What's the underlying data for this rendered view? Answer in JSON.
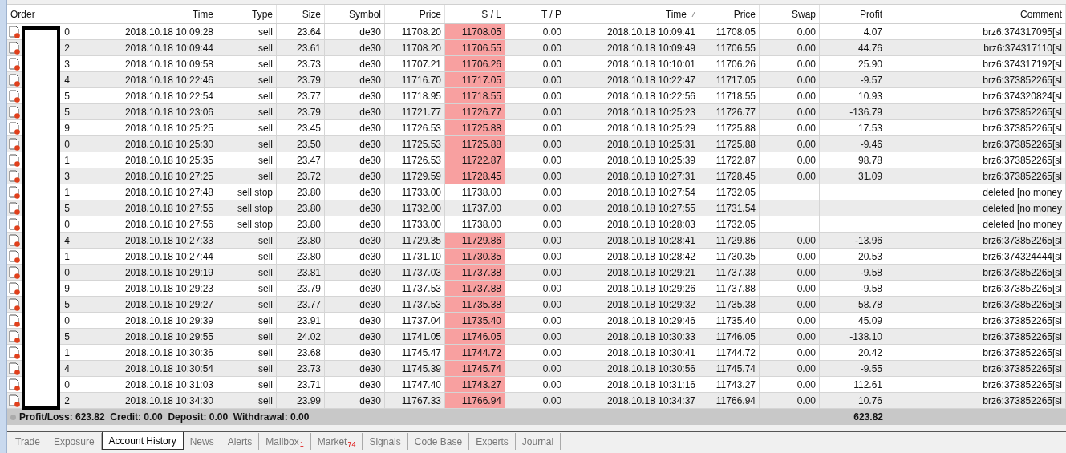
{
  "columns": [
    {
      "label": "Order",
      "sorted": false
    },
    {
      "label": "Time",
      "sorted": false
    },
    {
      "label": "Type",
      "sorted": false
    },
    {
      "label": "Size",
      "sorted": false
    },
    {
      "label": "Symbol",
      "sorted": false
    },
    {
      "label": "Price",
      "sorted": false
    },
    {
      "label": "S / L",
      "sorted": false
    },
    {
      "label": "T / P",
      "sorted": false
    },
    {
      "label": "Time",
      "sorted": true
    },
    {
      "label": "Price",
      "sorted": false
    },
    {
      "label": "Swap",
      "sorted": false
    },
    {
      "label": "Profit",
      "sorted": false
    },
    {
      "label": "Comment",
      "sorted": false
    }
  ],
  "rows": [
    {
      "order": "0",
      "time": "2018.10.18 10:09:28",
      "type": "sell",
      "size": "23.64",
      "symbol": "de30",
      "price": "11708.20",
      "sl": "11708.05",
      "sl_hit": true,
      "tp": "0.00",
      "close_time": "2018.10.18 10:09:41",
      "close_price": "11708.05",
      "swap": "0.00",
      "profit": "4.07",
      "comment": "brz6:374317095[sl"
    },
    {
      "order": "2",
      "time": "2018.10.18 10:09:44",
      "type": "sell",
      "size": "23.61",
      "symbol": "de30",
      "price": "11708.20",
      "sl": "11706.55",
      "sl_hit": true,
      "tp": "0.00",
      "close_time": "2018.10.18 10:09:49",
      "close_price": "11706.55",
      "swap": "0.00",
      "profit": "44.76",
      "comment": "brz6:374317110[sl"
    },
    {
      "order": "3",
      "time": "2018.10.18 10:09:58",
      "type": "sell",
      "size": "23.73",
      "symbol": "de30",
      "price": "11707.21",
      "sl": "11706.26",
      "sl_hit": true,
      "tp": "0.00",
      "close_time": "2018.10.18 10:10:01",
      "close_price": "11706.26",
      "swap": "0.00",
      "profit": "25.90",
      "comment": "brz6:374317192[sl"
    },
    {
      "order": "4",
      "time": "2018.10.18 10:22:46",
      "type": "sell",
      "size": "23.79",
      "symbol": "de30",
      "price": "11716.70",
      "sl": "11717.05",
      "sl_hit": true,
      "tp": "0.00",
      "close_time": "2018.10.18 10:22:47",
      "close_price": "11717.05",
      "swap": "0.00",
      "profit": "-9.57",
      "comment": "brz6:373852265[sl"
    },
    {
      "order": "5",
      "time": "2018.10.18 10:22:54",
      "type": "sell",
      "size": "23.77",
      "symbol": "de30",
      "price": "11718.95",
      "sl": "11718.55",
      "sl_hit": true,
      "tp": "0.00",
      "close_time": "2018.10.18 10:22:56",
      "close_price": "11718.55",
      "swap": "0.00",
      "profit": "10.93",
      "comment": "brz6:374320824[sl"
    },
    {
      "order": "5",
      "time": "2018.10.18 10:23:06",
      "type": "sell",
      "size": "23.79",
      "symbol": "de30",
      "price": "11721.77",
      "sl": "11726.77",
      "sl_hit": true,
      "tp": "0.00",
      "close_time": "2018.10.18 10:25:23",
      "close_price": "11726.77",
      "swap": "0.00",
      "profit": "-136.79",
      "comment": "brz6:373852265[sl"
    },
    {
      "order": "9",
      "time": "2018.10.18 10:25:25",
      "type": "sell",
      "size": "23.45",
      "symbol": "de30",
      "price": "11726.53",
      "sl": "11725.88",
      "sl_hit": true,
      "tp": "0.00",
      "close_time": "2018.10.18 10:25:29",
      "close_price": "11725.88",
      "swap": "0.00",
      "profit": "17.53",
      "comment": "brz6:373852265[sl"
    },
    {
      "order": "0",
      "time": "2018.10.18 10:25:30",
      "type": "sell",
      "size": "23.50",
      "symbol": "de30",
      "price": "11725.53",
      "sl": "11725.88",
      "sl_hit": true,
      "tp": "0.00",
      "close_time": "2018.10.18 10:25:31",
      "close_price": "11725.88",
      "swap": "0.00",
      "profit": "-9.46",
      "comment": "brz6:373852265[sl"
    },
    {
      "order": "1",
      "time": "2018.10.18 10:25:35",
      "type": "sell",
      "size": "23.47",
      "symbol": "de30",
      "price": "11726.53",
      "sl": "11722.87",
      "sl_hit": true,
      "tp": "0.00",
      "close_time": "2018.10.18 10:25:39",
      "close_price": "11722.87",
      "swap": "0.00",
      "profit": "98.78",
      "comment": "brz6:373852265[sl"
    },
    {
      "order": "3",
      "time": "2018.10.18 10:27:25",
      "type": "sell",
      "size": "23.72",
      "symbol": "de30",
      "price": "11729.59",
      "sl": "11728.45",
      "sl_hit": true,
      "tp": "0.00",
      "close_time": "2018.10.18 10:27:31",
      "close_price": "11728.45",
      "swap": "0.00",
      "profit": "31.09",
      "comment": "brz6:373852265[sl"
    },
    {
      "order": "1",
      "time": "2018.10.18 10:27:48",
      "type": "sell stop",
      "size": "23.80",
      "symbol": "de30",
      "price": "11733.00",
      "sl": "11738.00",
      "sl_hit": false,
      "tp": "0.00",
      "close_time": "2018.10.18 10:27:54",
      "close_price": "11732.05",
      "comment": "deleted [no money"
    },
    {
      "order": "5",
      "time": "2018.10.18 10:27:55",
      "type": "sell stop",
      "size": "23.80",
      "symbol": "de30",
      "price": "11732.00",
      "sl": "11737.00",
      "sl_hit": false,
      "tp": "0.00",
      "close_time": "2018.10.18 10:27:55",
      "close_price": "11731.54",
      "comment": "deleted [no money"
    },
    {
      "order": "0",
      "time": "2018.10.18 10:27:56",
      "type": "sell stop",
      "size": "23.80",
      "symbol": "de30",
      "price": "11733.00",
      "sl": "11738.00",
      "sl_hit": false,
      "tp": "0.00",
      "close_time": "2018.10.18 10:28:03",
      "close_price": "11732.05",
      "comment": "deleted [no money"
    },
    {
      "order": "4",
      "time": "2018.10.18 10:27:33",
      "type": "sell",
      "size": "23.80",
      "symbol": "de30",
      "price": "11729.35",
      "sl": "11729.86",
      "sl_hit": true,
      "tp": "0.00",
      "close_time": "2018.10.18 10:28:41",
      "close_price": "11729.86",
      "swap": "0.00",
      "profit": "-13.96",
      "comment": "brz6:373852265[sl"
    },
    {
      "order": "1",
      "time": "2018.10.18 10:27:44",
      "type": "sell",
      "size": "23.80",
      "symbol": "de30",
      "price": "11731.10",
      "sl": "11730.35",
      "sl_hit": true,
      "tp": "0.00",
      "close_time": "2018.10.18 10:28:42",
      "close_price": "11730.35",
      "swap": "0.00",
      "profit": "20.53",
      "comment": "brz6:374324444[sl"
    },
    {
      "order": "0",
      "time": "2018.10.18 10:29:19",
      "type": "sell",
      "size": "23.81",
      "symbol": "de30",
      "price": "11737.03",
      "sl": "11737.38",
      "sl_hit": true,
      "tp": "0.00",
      "close_time": "2018.10.18 10:29:21",
      "close_price": "11737.38",
      "swap": "0.00",
      "profit": "-9.58",
      "comment": "brz6:373852265[sl"
    },
    {
      "order": "9",
      "time": "2018.10.18 10:29:23",
      "type": "sell",
      "size": "23.79",
      "symbol": "de30",
      "price": "11737.53",
      "sl": "11737.88",
      "sl_hit": true,
      "tp": "0.00",
      "close_time": "2018.10.18 10:29:26",
      "close_price": "11737.88",
      "swap": "0.00",
      "profit": "-9.58",
      "comment": "brz6:373852265[sl"
    },
    {
      "order": "5",
      "time": "2018.10.18 10:29:27",
      "type": "sell",
      "size": "23.77",
      "symbol": "de30",
      "price": "11737.53",
      "sl": "11735.38",
      "sl_hit": true,
      "tp": "0.00",
      "close_time": "2018.10.18 10:29:32",
      "close_price": "11735.38",
      "swap": "0.00",
      "profit": "58.78",
      "comment": "brz6:373852265[sl"
    },
    {
      "order": "0",
      "time": "2018.10.18 10:29:39",
      "type": "sell",
      "size": "23.91",
      "symbol": "de30",
      "price": "11737.04",
      "sl": "11735.40",
      "sl_hit": true,
      "tp": "0.00",
      "close_time": "2018.10.18 10:29:46",
      "close_price": "11735.40",
      "swap": "0.00",
      "profit": "45.09",
      "comment": "brz6:373852265[sl"
    },
    {
      "order": "5",
      "time": "2018.10.18 10:29:55",
      "type": "sell",
      "size": "24.02",
      "symbol": "de30",
      "price": "11741.05",
      "sl": "11746.05",
      "sl_hit": true,
      "tp": "0.00",
      "close_time": "2018.10.18 10:30:33",
      "close_price": "11746.05",
      "swap": "0.00",
      "profit": "-138.10",
      "comment": "brz6:373852265[sl"
    },
    {
      "order": "1",
      "time": "2018.10.18 10:30:36",
      "type": "sell",
      "size": "23.68",
      "symbol": "de30",
      "price": "11745.47",
      "sl": "11744.72",
      "sl_hit": true,
      "tp": "0.00",
      "close_time": "2018.10.18 10:30:41",
      "close_price": "11744.72",
      "swap": "0.00",
      "profit": "20.42",
      "comment": "brz6:373852265[sl"
    },
    {
      "order": "4",
      "time": "2018.10.18 10:30:54",
      "type": "sell",
      "size": "23.73",
      "symbol": "de30",
      "price": "11745.39",
      "sl": "11745.74",
      "sl_hit": true,
      "tp": "0.00",
      "close_time": "2018.10.18 10:30:56",
      "close_price": "11745.74",
      "swap": "0.00",
      "profit": "-9.55",
      "comment": "brz6:373852265[sl"
    },
    {
      "order": "0",
      "time": "2018.10.18 10:31:03",
      "type": "sell",
      "size": "23.71",
      "symbol": "de30",
      "price": "11747.40",
      "sl": "11743.27",
      "sl_hit": true,
      "tp": "0.00",
      "close_time": "2018.10.18 10:31:16",
      "close_price": "11743.27",
      "swap": "0.00",
      "profit": "112.61",
      "comment": "brz6:373852265[sl"
    },
    {
      "order": "2",
      "time": "2018.10.18 10:34:30",
      "type": "sell",
      "size": "23.99",
      "symbol": "de30",
      "price": "11767.33",
      "sl": "11766.94",
      "sl_hit": true,
      "tp": "0.00",
      "close_time": "2018.10.18 10:34:37",
      "close_price": "11766.94",
      "swap": "0.00",
      "profit": "10.76",
      "comment": "brz6:373852265[sl"
    }
  ],
  "summary": {
    "text": "Profit/Loss: 623.82  Credit: 0.00  Deposit: 0.00  Withdrawal: 0.00",
    "total": "623.82"
  },
  "tabs": [
    {
      "label": "Trade",
      "selected": false
    },
    {
      "label": "Exposure",
      "selected": false
    },
    {
      "label": "Account History",
      "selected": true
    },
    {
      "label": "News",
      "selected": false
    },
    {
      "label": "Alerts",
      "selected": false
    },
    {
      "label": "Mailbox",
      "badge": "1",
      "selected": false
    },
    {
      "label": "Market",
      "badge": "74",
      "selected": false
    },
    {
      "label": "Signals",
      "selected": false
    },
    {
      "label": "Code Base",
      "selected": false
    },
    {
      "label": "Experts",
      "selected": false
    },
    {
      "label": "Journal",
      "selected": false
    }
  ]
}
